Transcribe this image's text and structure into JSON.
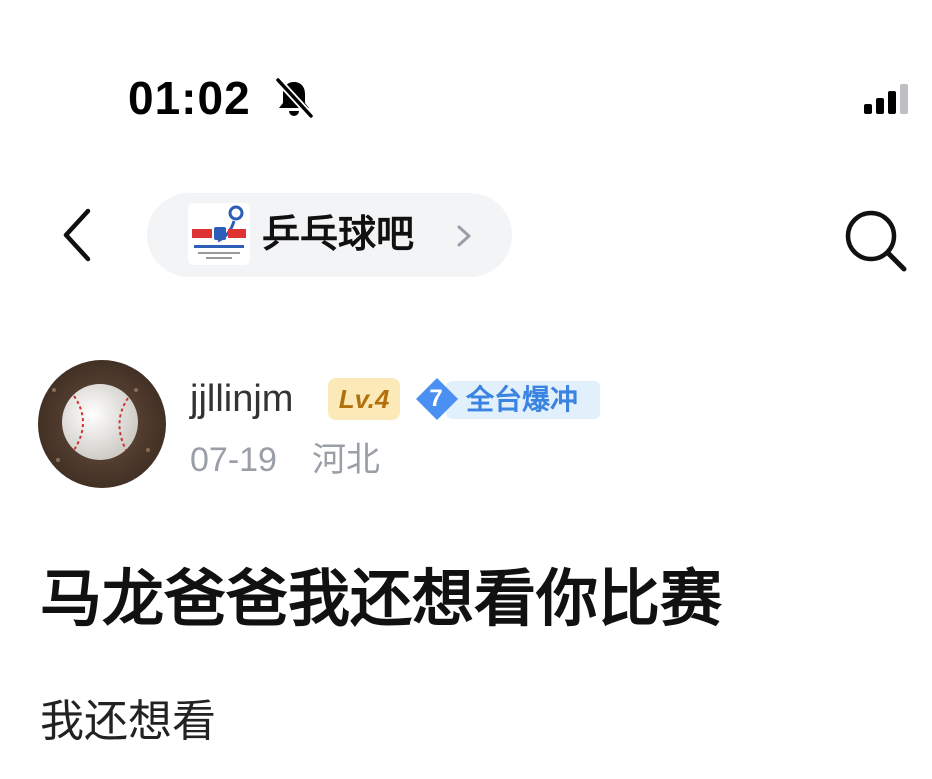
{
  "status_bar": {
    "time": "01:02",
    "icons": [
      "bell-muted-icon",
      "cellular-signal-icon"
    ]
  },
  "nav": {
    "back_icon": "chevron-left-icon",
    "forum_name": "乒乓球吧",
    "forum_chevron_icon": "chevron-right-icon",
    "search_icon": "search-icon"
  },
  "author": {
    "username": "jjllinjm",
    "level": "Lv.4",
    "rank_number": "7",
    "rank_title": "全台爆冲",
    "date": "07-19",
    "location": "河北"
  },
  "post": {
    "title": "马龙爸爸我还想看你比赛",
    "body": "我还想看"
  },
  "colors": {
    "level_bg": "#fbeab8",
    "level_text": "#b2710c",
    "rank_blue": "#3a83e0",
    "meta_gray": "#9a9ea6"
  }
}
